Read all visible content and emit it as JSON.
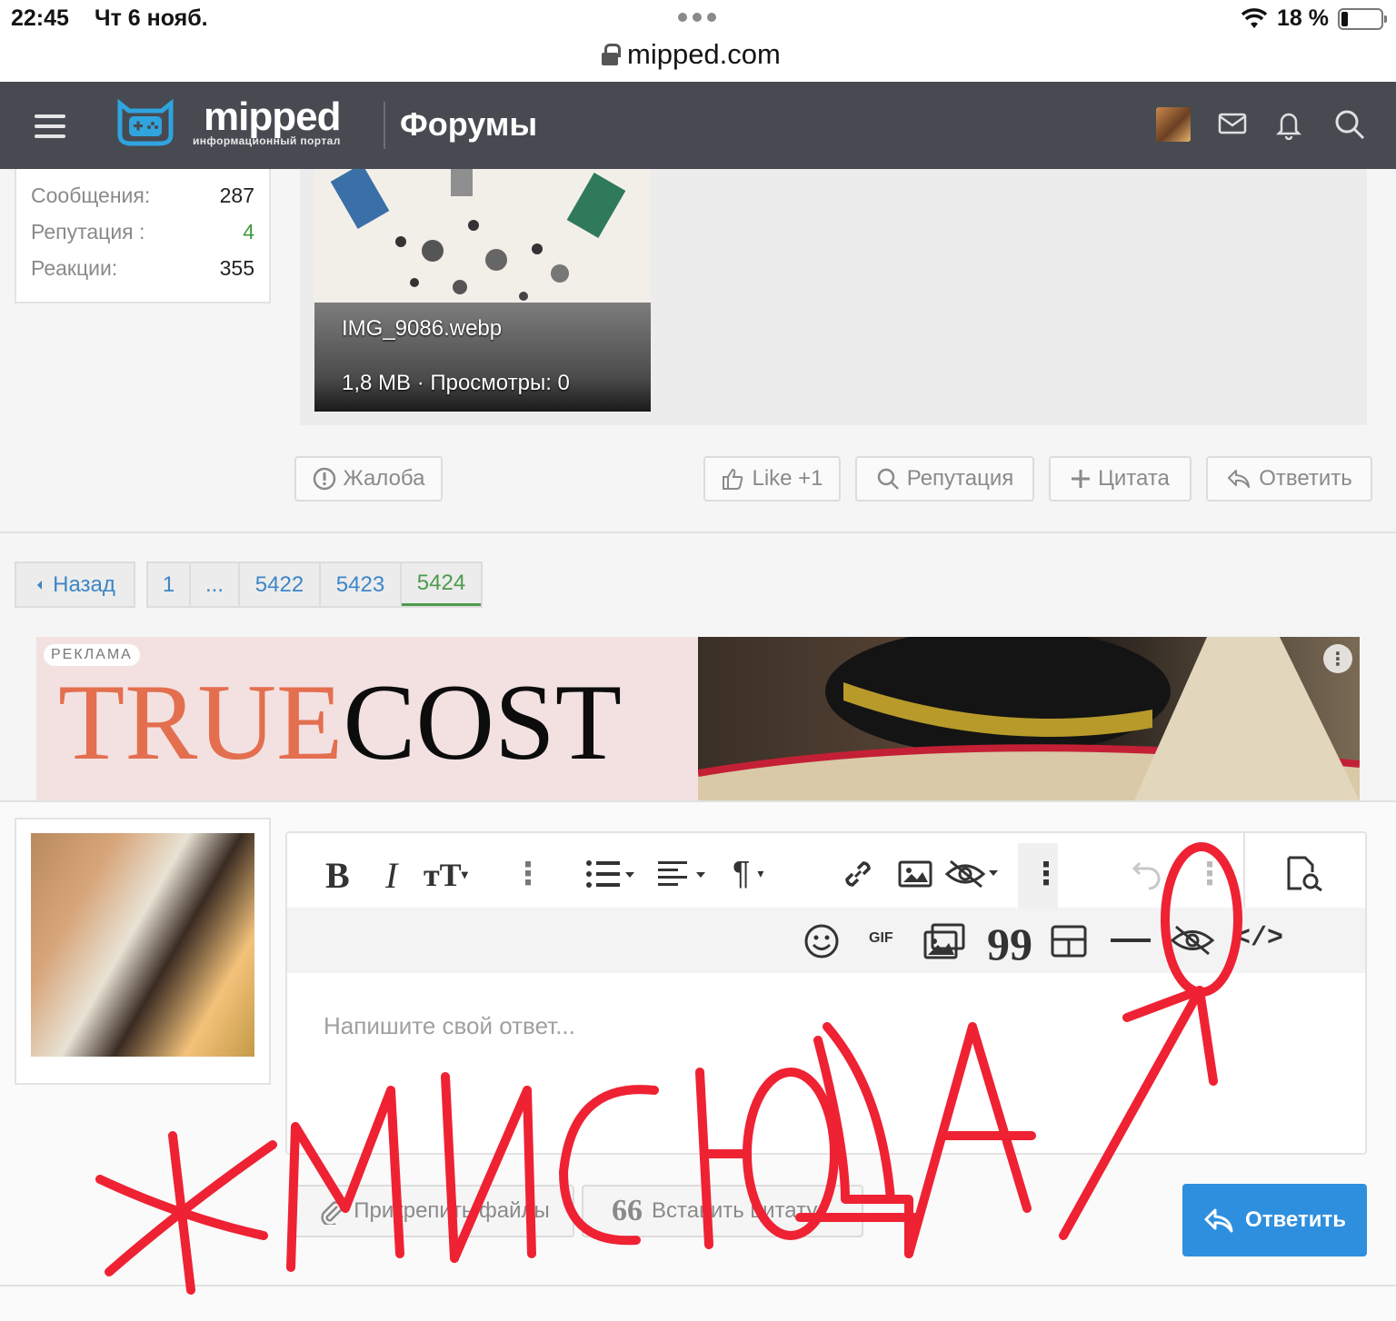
{
  "status_bar": {
    "time": "22:45",
    "date": "Чт 6 нояб.",
    "url": "mipped.com",
    "battery": "18 %"
  },
  "header": {
    "logo_text": "mipped",
    "logo_sub": "информационный портал",
    "title": "Форумы"
  },
  "user_stats": [
    {
      "label": "Сообщения:",
      "value": "287"
    },
    {
      "label": "Репутация :",
      "value": "4"
    },
    {
      "label": "Реакции:",
      "value": "355"
    }
  ],
  "attachment": {
    "name": "IMG_9086.webp",
    "meta": "1,8 MB · Просмотры: 0"
  },
  "post_actions": {
    "report": "Жалоба",
    "like": "Like +1",
    "reputation": "Репутация",
    "quote": "Цитата",
    "reply": "Ответить"
  },
  "pagination": {
    "back": "Назад",
    "pages": [
      "1",
      "...",
      "5422",
      "5423",
      "5424"
    ],
    "current": "5424"
  },
  "ad": {
    "label": "РЕКЛАМА",
    "brand_part1": "TRUE",
    "brand_part2": "COST"
  },
  "editor": {
    "placeholder": "Напишите свой ответ...",
    "toolbar_row1": [
      "bold-icon",
      "italic-icon",
      "text-size-icon",
      "more-vertical-icon",
      "list-icon",
      "align-icon",
      "paragraph-icon",
      "link-icon",
      "image-icon",
      "hide-icon",
      "more-vertical-icon",
      "undo-icon",
      "more-vertical-icon",
      "preview-icon"
    ],
    "toolbar_row2": [
      "emoji-icon",
      "gif-icon",
      "media-icon",
      "quote-icon",
      "table-icon",
      "horizontal-rule-icon",
      "hide-icon",
      "code-icon"
    ],
    "gif_label": "GIF",
    "attach_files": "Прикрепить файлы",
    "insert_quote": "Вставить цитату...",
    "submit": "Ответить"
  },
  "annotation": {
    "text": "ЖМИ СЮДА",
    "color": "#ee2233"
  }
}
